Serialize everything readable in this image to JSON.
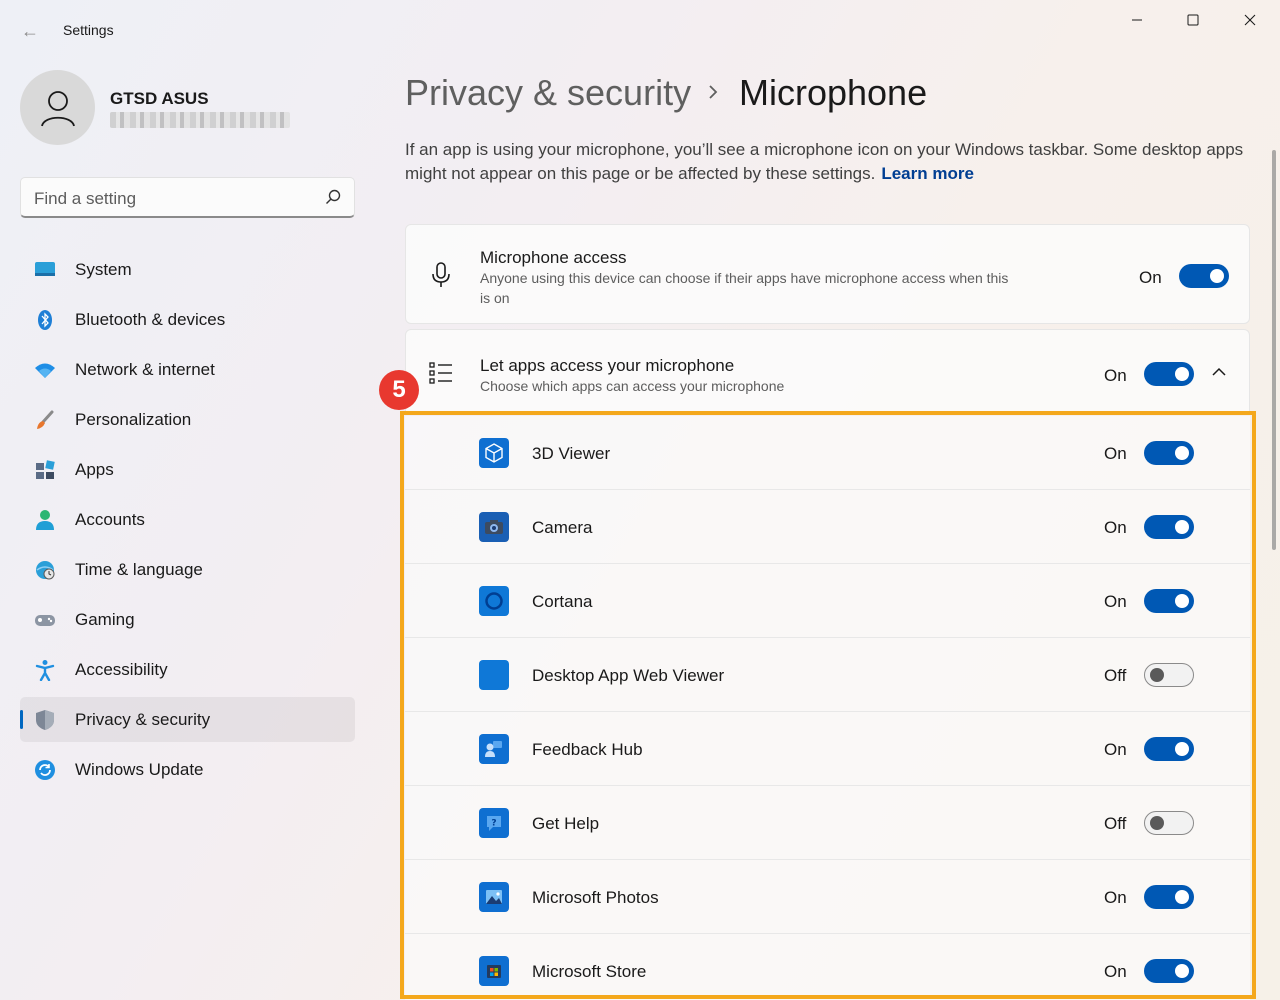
{
  "window": {
    "title": "Settings",
    "back_glyph": "←"
  },
  "profile": {
    "name": "GTSD ASUS"
  },
  "search": {
    "placeholder": "Find a setting"
  },
  "sidebar": {
    "items": [
      {
        "label": "System",
        "icon": "system-icon"
      },
      {
        "label": "Bluetooth & devices",
        "icon": "bluetooth-icon"
      },
      {
        "label": "Network & internet",
        "icon": "wifi-icon"
      },
      {
        "label": "Personalization",
        "icon": "brush-icon"
      },
      {
        "label": "Apps",
        "icon": "apps-icon"
      },
      {
        "label": "Accounts",
        "icon": "accounts-icon"
      },
      {
        "label": "Time & language",
        "icon": "globe-clock-icon"
      },
      {
        "label": "Gaming",
        "icon": "gamepad-icon"
      },
      {
        "label": "Accessibility",
        "icon": "accessibility-icon"
      },
      {
        "label": "Privacy & security",
        "icon": "shield-icon",
        "active": true
      },
      {
        "label": "Windows Update",
        "icon": "update-icon"
      }
    ]
  },
  "header": {
    "parent": "Privacy & security",
    "current": "Microphone",
    "description": "If an app is using your microphone, you’ll see a microphone icon on your Windows taskbar. Some desktop apps might not appear on this page or be affected by these settings.",
    "learn_more": "Learn more"
  },
  "mic_access": {
    "title": "Microphone access",
    "subtitle": "Anyone using this device can choose if their apps have microphone access when this is on",
    "state": "On",
    "enabled": true
  },
  "app_access": {
    "title": "Let apps access your microphone",
    "subtitle": "Choose which apps can access your microphone",
    "state": "On",
    "enabled": true,
    "expanded": true
  },
  "apps": [
    {
      "name": "3D Viewer",
      "state": "On",
      "enabled": true,
      "icon": "cube-icon"
    },
    {
      "name": "Camera",
      "state": "On",
      "enabled": true,
      "icon": "camera-icon"
    },
    {
      "name": "Cortana",
      "state": "On",
      "enabled": true,
      "icon": "cortana-icon"
    },
    {
      "name": "Desktop App Web Viewer",
      "state": "Off",
      "enabled": false,
      "icon": "web-viewer-icon"
    },
    {
      "name": "Feedback Hub",
      "state": "On",
      "enabled": true,
      "icon": "feedback-hub-icon"
    },
    {
      "name": "Get Help",
      "state": "Off",
      "enabled": false,
      "icon": "get-help-icon"
    },
    {
      "name": "Microsoft Photos",
      "state": "On",
      "enabled": true,
      "icon": "photos-icon"
    },
    {
      "name": "Microsoft Store",
      "state": "On",
      "enabled": true,
      "icon": "store-icon"
    }
  ],
  "annotation": {
    "step": "5",
    "highlight_color": "#f4a81c",
    "badge_color": "#e8382f"
  },
  "colors": {
    "accent": "#0058b4",
    "link": "#003e92"
  }
}
